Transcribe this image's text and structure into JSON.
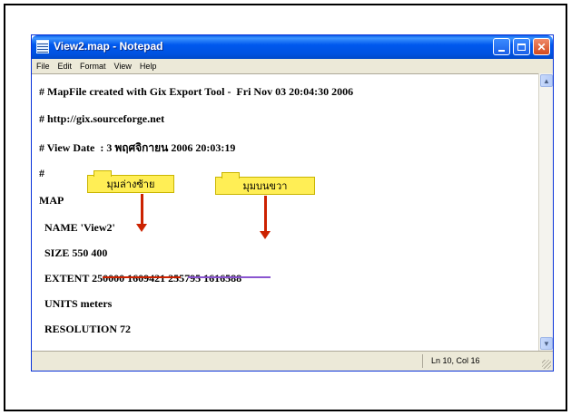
{
  "window": {
    "title": "View2.map - Notepad",
    "buttons": {
      "minimize": "",
      "maximize": "",
      "close": "✕"
    }
  },
  "menu": [
    "File",
    "Edit",
    "Format",
    "View",
    "Help"
  ],
  "lines": [
    "# MapFile created with Gix Export Tool -  Fri Nov 03 20:04:30 2006",
    "# http://gix.sourceforge.net",
    "# View Date  : 3 พฤศจิกายน 2006 20:03:19",
    "#",
    "MAP",
    "NAME 'View2'",
    "SIZE 550 400",
    "EXTENT 250000 1609421 255795 1616588",
    "UNITS meters",
    "RESOLUTION 72"
  ],
  "status": {
    "position": "Ln 10, Col 16"
  },
  "annotations": {
    "lower_left": "มุมล่างซ้าย",
    "upper_right": "มุมบนขวา"
  },
  "colors": {
    "lower_left_underline": "#cc2200",
    "upper_right_underline": "#8a55d0",
    "callout_fill": "#ffee55",
    "titlebar": "#0058ee"
  },
  "icons": {
    "app": "notepad-icon",
    "scroll_up": "chevron-up-icon",
    "scroll_down": "chevron-down-icon"
  }
}
